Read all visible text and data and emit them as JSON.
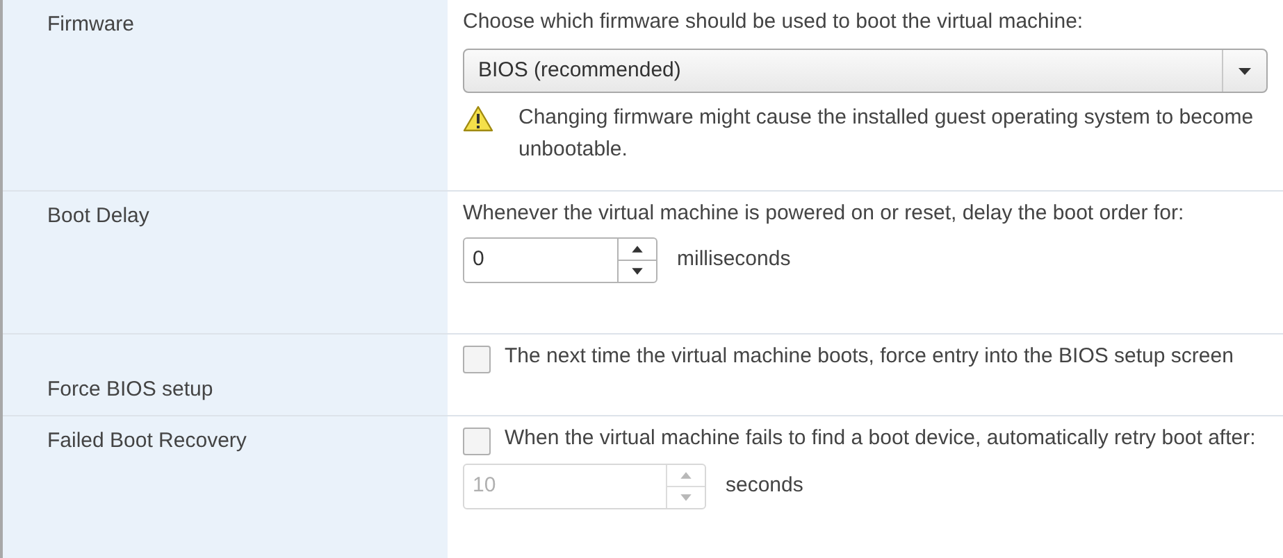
{
  "rows": [
    {
      "kind": "select",
      "label": "Firmware",
      "description": "Choose which firmware should be used to boot the virtual machine:",
      "select": {
        "value": "BIOS (recommended)"
      },
      "warning": "Changing firmware might cause the installed guest operating system to become unbootable."
    },
    {
      "kind": "spinner",
      "label": "Boot Delay",
      "description": "Whenever the virtual machine is powered on or reset, delay the boot order for:",
      "spinner": {
        "value": "0",
        "unit": "milliseconds",
        "disabled": false
      }
    },
    {
      "kind": "checkbox",
      "label": "Force BIOS setup",
      "checkbox": {
        "checked": false,
        "text": "The next time the virtual machine boots, force entry into the BIOS setup screen"
      }
    },
    {
      "kind": "checkbox",
      "label": "Failed Boot Recovery",
      "checkbox": {
        "checked": false,
        "text": "When the virtual machine fails to find a boot device, automatically retry boot after:"
      },
      "spinner": {
        "value": "10",
        "unit": "seconds",
        "disabled": true
      }
    }
  ]
}
